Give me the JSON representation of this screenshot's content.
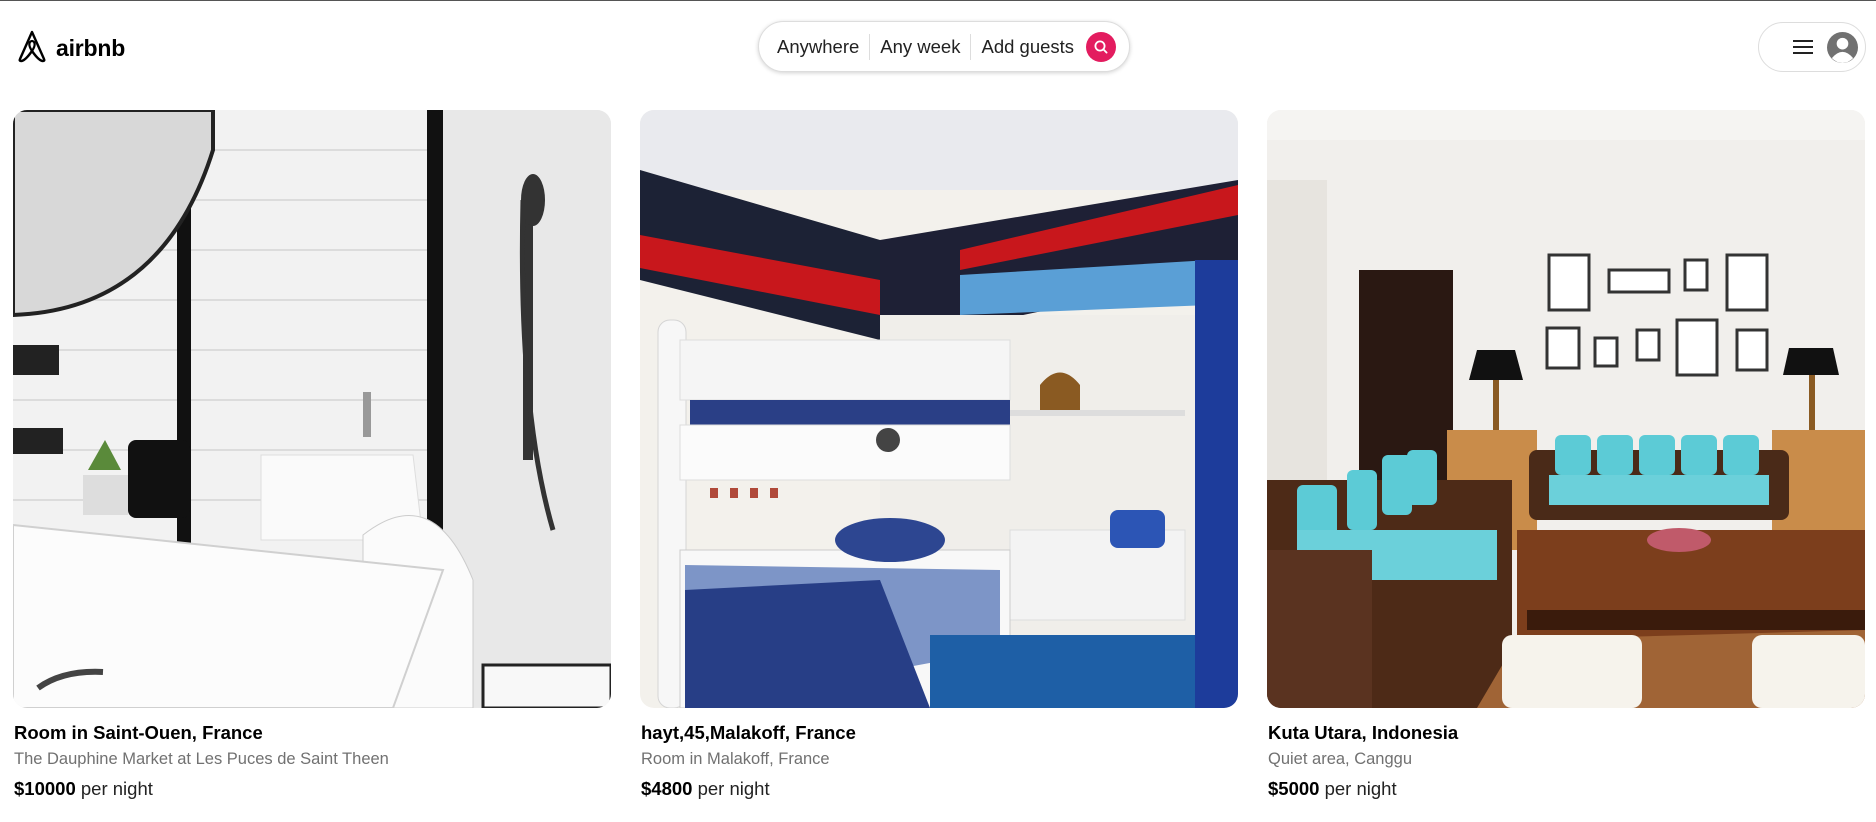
{
  "brand": {
    "name": "airbnb",
    "logo_icon": "airbnb-logo-icon"
  },
  "search": {
    "where": "Anywhere",
    "when": "Any week",
    "who": "Add guests",
    "button_icon": "search-icon",
    "accent_color": "#e31c5f"
  },
  "user_menu": {
    "menu_icon": "hamburger-menu-icon",
    "avatar_icon": "user-avatar-icon"
  },
  "listings": [
    {
      "title": "Room in Saint-Ouen, France",
      "subtitle": "The Dauphine Market at Les Puces de Saint Theen",
      "price": "$10000",
      "price_unit": "per night"
    },
    {
      "title": "hayt,45,Malakoff, France",
      "subtitle": "Room in Malakoff, France",
      "price": "$4800",
      "price_unit": "per night"
    },
    {
      "title": "Kuta Utara, Indonesia",
      "subtitle": "Quiet area, Canggu",
      "price": "$5000",
      "price_unit": "per night"
    }
  ]
}
